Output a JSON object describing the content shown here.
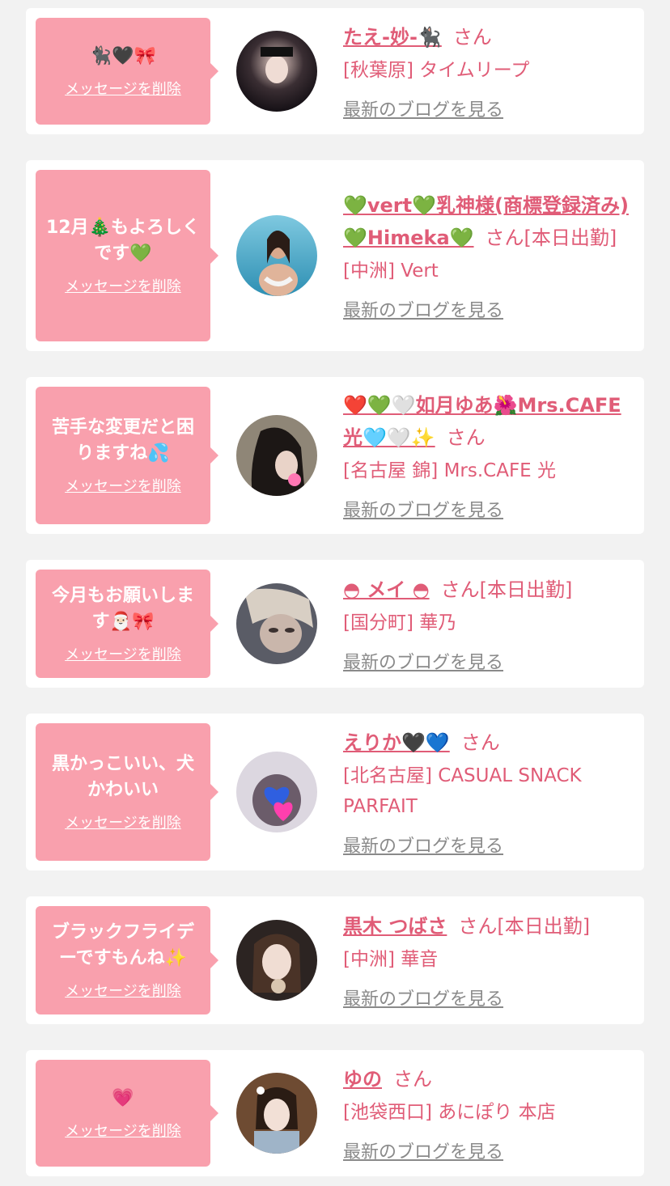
{
  "delete_label": "メッセージを削除",
  "san_label": "さん",
  "blog_label": "最新のブログを見る",
  "colors": {
    "background": "#f2f2f2",
    "bubble": "#f9a0ad",
    "accent": "#e05c77",
    "link_gray": "#8a8a8a"
  },
  "cards": [
    {
      "message": "🐈‍⬛🖤🎀",
      "name": "たえ-妙-🐈‍⬛",
      "status": "",
      "shop": "[秋葉原] タイムリープ"
    },
    {
      "message": "12月🎄もよろしくです💚",
      "name": "💚vert💚乳神様(商標登録済み)💚Himeka💚",
      "status": "[本日出勤]",
      "shop": "[中洲] Vert"
    },
    {
      "message": "苦手な変更だと困りますね💦",
      "name": "❤️💚🤍如月ゆあ🌺Mrs.CAFE光🩵🤍✨",
      "status": "",
      "shop": "[名古屋 錦] Mrs.CAFE 光"
    },
    {
      "message": "今月もお願いします🎅🏻🎀",
      "name": "◓ メイ ◓",
      "status": "[本日出勤]",
      "shop": "[国分町] 華乃"
    },
    {
      "message": "黒かっこいい、犬かわいい",
      "name": "えりか🖤💙",
      "status": "",
      "shop": "[北名古屋] CASUAL SNACK PARFAIT"
    },
    {
      "message": "ブラックフライデーですもんね✨",
      "name": "黒木 つばさ",
      "status": "[本日出勤]",
      "shop": "[中洲] 華音"
    },
    {
      "message": "💗",
      "name": "ゆの",
      "status": "",
      "shop": "[池袋西口] あにぽり 本店"
    }
  ]
}
